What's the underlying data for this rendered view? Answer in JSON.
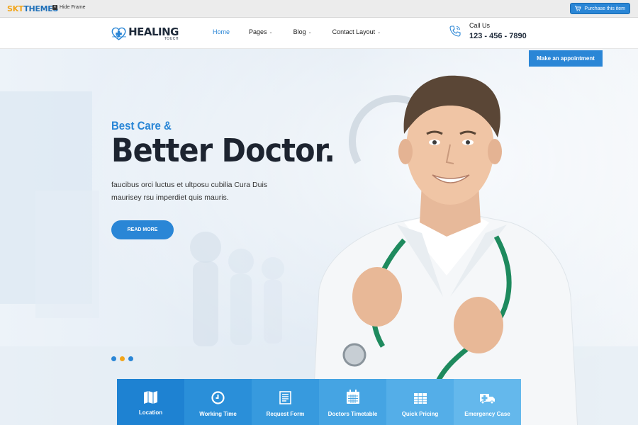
{
  "frame": {
    "brand_part1": "SKT",
    "brand_part2": "THEMES",
    "hide_frame": "Hide Frame",
    "purchase": "Purchase this item"
  },
  "header": {
    "logo_line1": "HEALING",
    "logo_line2": "TOUCH",
    "nav": [
      {
        "label": "Home",
        "active": true
      },
      {
        "label": "Pages",
        "has_dropdown": true
      },
      {
        "label": "Blog",
        "has_dropdown": true
      },
      {
        "label": "Contact Layout",
        "has_dropdown": true
      }
    ],
    "call_label": "Call Us",
    "phone": "123 - 456 - 7890"
  },
  "hero": {
    "appointment_button": "Make an appointment",
    "kicker": "Best Care &",
    "headline": "Better Doctor.",
    "description": "faucibus orci luctus et ultposu cubilia Cura Duis maurisey rsu imperdiet quis mauris.",
    "read_more": "READ MORE",
    "slider_dots": [
      "#2a86d6",
      "#f2a51a",
      "#2a86d6"
    ]
  },
  "features": [
    {
      "label": "Location",
      "icon": "map-icon",
      "color": "#1e82d2"
    },
    {
      "label": "Working Time",
      "icon": "clock-icon",
      "color": "#2a8fd9"
    },
    {
      "label": "Request Form",
      "icon": "form-icon",
      "color": "#379ade"
    },
    {
      "label": "Doctors Timetable",
      "icon": "calendar-icon",
      "color": "#45a4e3"
    },
    {
      "label": "Quick Pricing",
      "icon": "pricing-table-icon",
      "color": "#54aee8"
    },
    {
      "label": "Emergency Case",
      "icon": "ambulance-icon",
      "color": "#64b8ec"
    }
  ],
  "colors": {
    "accent": "#2a86d6",
    "dark": "#1d2430",
    "orange": "#f2a51a"
  }
}
